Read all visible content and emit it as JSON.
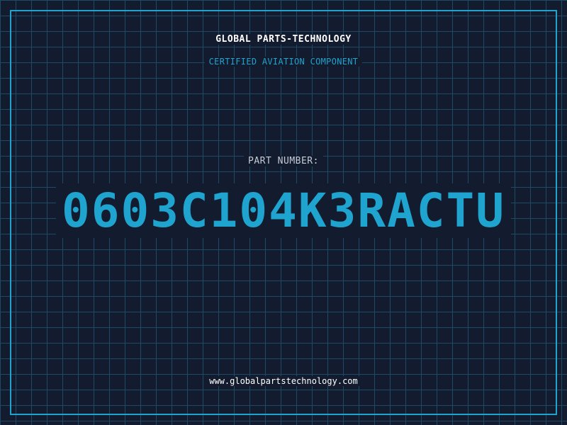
{
  "header": {
    "company": "GLOBAL PARTS-TECHNOLOGY",
    "tagline": "CERTIFIED AVIATION COMPONENT"
  },
  "part": {
    "label": "PART NUMBER:",
    "number": "0603C104K3RACTU"
  },
  "footer": {
    "website": "www.globalpartstechnology.com"
  },
  "colors": {
    "background": "#131b2e",
    "grid": "#1e4a66",
    "accent": "#1fa3cf",
    "text": "#ffffff"
  }
}
